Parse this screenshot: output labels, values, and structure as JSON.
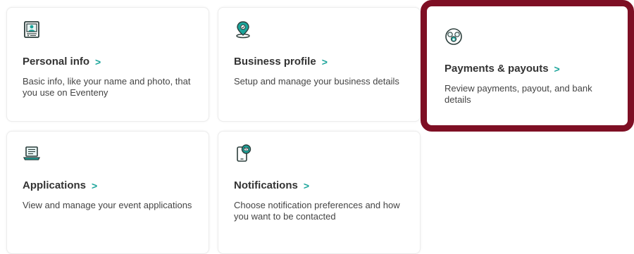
{
  "cards": [
    {
      "icon": "id-badge-icon",
      "title": "Personal info",
      "chevron": ">",
      "description": "Basic info, like your name and photo, that you use on Eventeny"
    },
    {
      "icon": "location-pin-icon",
      "title": "Business profile",
      "chevron": ">",
      "description": "Setup and manage your business details"
    },
    {
      "icon": "payments-icon",
      "title": "Payments & payouts",
      "chevron": ">",
      "description": "Review payments, payout, and bank details"
    },
    {
      "icon": "laptop-icon",
      "title": "Applications",
      "chevron": ">",
      "description": "View and manage your event applications"
    },
    {
      "icon": "phone-notification-icon",
      "title": "Notifications",
      "chevron": ">",
      "description": "Choose notification preferences and how you want to be contacted"
    }
  ],
  "colors": {
    "accent": "#1aa49a",
    "highlight_border": "#7e0f24",
    "icon_dark": "#2c3e3c"
  }
}
